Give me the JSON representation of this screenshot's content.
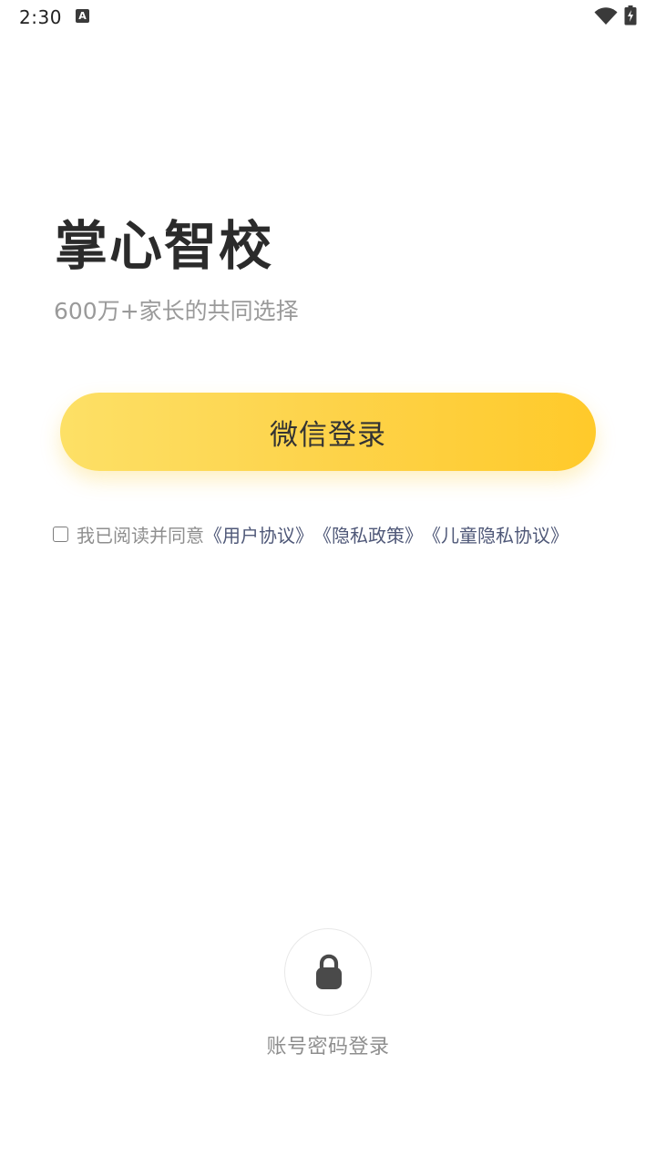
{
  "status_bar": {
    "time": "2:30",
    "notification_icon_letter": "A",
    "icons": [
      "wifi-icon",
      "battery-charging-icon"
    ]
  },
  "app": {
    "title": "掌心智校",
    "subtitle": "600万+家长的共同选择"
  },
  "login": {
    "wechat_button_label": "微信登录",
    "agreement_prefix": "我已阅读并同意",
    "agreement_links": [
      "《用户协议》",
      "《隐私政策》",
      "《儿童隐私协议》"
    ],
    "agreement_checked": false,
    "account_login_label": "账号密码登录",
    "account_login_icon": "lock-icon"
  },
  "colors": {
    "button_gradient_start": "#fde066",
    "button_gradient_end": "#ffca2a",
    "link": "#4f5878",
    "title": "#2b2b2b",
    "muted_text": "#9a9a9a"
  }
}
